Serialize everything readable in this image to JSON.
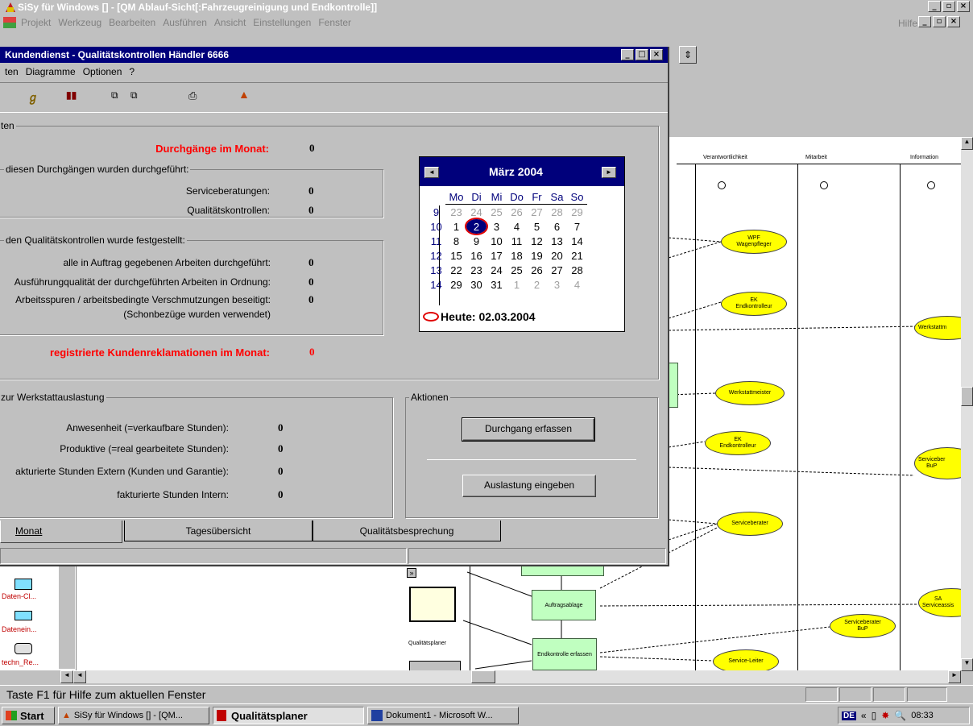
{
  "main_title": "SiSy für Windows [] - [QM Ablauf-Sicht[:Fahrzeugreinigung und Endkontrolle]]",
  "main_menu": [
    "Projekt",
    "Werkzeug",
    "Bearbeiten",
    "Ausführen",
    "Ansicht",
    "Einstellungen",
    "Fenster"
  ],
  "main_help": "Hilfe",
  "dialog": {
    "title": "Kundendienst - Qualitätskontrollen  Händler 6666",
    "menu": [
      "ten",
      "Diagramme",
      "Optionen",
      "?"
    ],
    "group1_caption": "ten",
    "durchgaenge_label": "Durchgänge im Monat:",
    "durchgaenge_value": "0",
    "sub1_caption": "diesen Durchgängen wurden durchgeführt:",
    "serviceberatungen_label": "Serviceberatungen:",
    "serviceberatungen_value": "0",
    "qk_label": "Qualitätskontrollen:",
    "qk_value": "0",
    "sub2_caption": "den Qualitätskontrollen wurde festgestellt:",
    "check1_label": "alle in Auftrag gegebenen Arbeiten durchgeführt:",
    "check1_value": "0",
    "check2_label": "Ausführungqualität der durchgeführten Arbeiten in Ordnung:",
    "check2_value": "0",
    "check3_label": "Arbeitsspuren / arbeitsbedingte Verschmutzungen beseitigt:",
    "check3_value": "0",
    "check3_sub": "(Schonbezüge wurden verwendet)",
    "reklam_label": "registrierte Kundenreklamationen im Monat:",
    "reklam_value": "0",
    "group2_caption": "zur Werkstattauslastung",
    "w1_label": "Anwesenheit (=verkaufbare Stunden):",
    "w1_value": "0",
    "w2_label": "Produktive (=real gearbeitete Stunden):",
    "w2_value": "0",
    "w3_label": "akturierte Stunden Extern (Kunden und Garantie):",
    "w3_value": "0",
    "w4_label": "fakturierte Stunden Intern:",
    "w4_value": "0",
    "aktionen_caption": "Aktionen",
    "btn_durchgang": "Durchgang erfassen",
    "btn_auslastung": "Auslastung eingeben",
    "tabs": [
      "Monat",
      "Tagesübersicht",
      "Qualitätsbesprechung"
    ]
  },
  "calendar": {
    "month": "März 2004",
    "days": [
      "Mo",
      "Di",
      "Mi",
      "Do",
      "Fr",
      "Sa",
      "So"
    ],
    "weeks": [
      {
        "wk": "9",
        "d": [
          "23",
          "24",
          "25",
          "26",
          "27",
          "28",
          "29"
        ],
        "grey": [
          1,
          1,
          1,
          1,
          1,
          1,
          1
        ]
      },
      {
        "wk": "10",
        "d": [
          "1",
          "2",
          "3",
          "4",
          "5",
          "6",
          "7"
        ],
        "grey": [
          0,
          0,
          0,
          0,
          0,
          0,
          0
        ]
      },
      {
        "wk": "11",
        "d": [
          "8",
          "9",
          "10",
          "11",
          "12",
          "13",
          "14"
        ],
        "grey": [
          0,
          0,
          0,
          0,
          0,
          0,
          0
        ]
      },
      {
        "wk": "12",
        "d": [
          "15",
          "16",
          "17",
          "18",
          "19",
          "20",
          "21"
        ],
        "grey": [
          0,
          0,
          0,
          0,
          0,
          0,
          0
        ]
      },
      {
        "wk": "13",
        "d": [
          "22",
          "23",
          "24",
          "25",
          "26",
          "27",
          "28"
        ],
        "grey": [
          0,
          0,
          0,
          0,
          0,
          0,
          0
        ]
      },
      {
        "wk": "14",
        "d": [
          "29",
          "30",
          "31",
          "1",
          "2",
          "3",
          "4"
        ],
        "grey": [
          0,
          0,
          0,
          1,
          1,
          1,
          1
        ]
      }
    ],
    "today": "Heute: 02.03.2004"
  },
  "diagram": {
    "lanes": [
      "Verantwortlichkeit",
      "Mitarbeit",
      "Information"
    ],
    "ellipses": [
      {
        "t1": "WPF",
        "t2": "Wagenpfleger"
      },
      {
        "t1": "EK",
        "t2": "Endkontrolleur"
      },
      {
        "t1": "",
        "t2": "Werkstattmeister"
      },
      {
        "t1": "EK",
        "t2": "Endkontrolleur"
      },
      {
        "t1": "",
        "t2": "Serviceberater"
      },
      {
        "t1": "",
        "t2": "Service-Leiter"
      },
      {
        "t1": "Serviceberater",
        "t2": "BuP"
      },
      {
        "t1": "",
        "t2": "Werkstattm"
      },
      {
        "t1": "Serviceber",
        "t2": "BuP"
      },
      {
        "t1": "SA",
        "t2": "Serviceassis"
      }
    ],
    "processes": [
      "Auftragsablage",
      "Endkontrolle erfassen"
    ],
    "qp_label": "Qualitätsplaner",
    "palette": [
      "Daten-Cl...",
      "Datenein...",
      "techn_Re..."
    ]
  },
  "statusbar": "Taste F1 für Hilfe zum aktuellen Fenster",
  "taskbar": {
    "start": "Start",
    "items": [
      "SiSy für Windows [] - [QM...",
      "Qualitätsplaner",
      "Dokument1 - Microsoft W..."
    ],
    "clock": "08:33",
    "lang": "DE"
  }
}
